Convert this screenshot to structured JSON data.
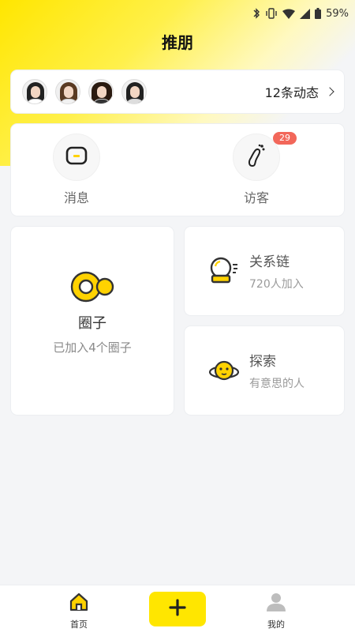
{
  "status_bar": {
    "battery": "59%",
    "icons": [
      "bluetooth-icon",
      "vibrate-icon",
      "wifi-icon",
      "signal-icon",
      "battery-icon"
    ]
  },
  "header": {
    "title": "推朋"
  },
  "feed": {
    "avatars": [
      "avatar-1",
      "avatar-2",
      "avatar-3",
      "avatar-4"
    ],
    "count_text": "12条动态",
    "arrow_icon": "chevron-right-icon"
  },
  "quick": {
    "messages": {
      "label": "消息",
      "icon": "message-icon"
    },
    "visitors": {
      "label": "访客",
      "badge": "29",
      "icon": "footprint-icon"
    }
  },
  "cards": {
    "circles": {
      "title": "圈子",
      "subtitle": "已加入4个圈子",
      "icon": "circle-group-icon"
    },
    "relations": {
      "title": "关系链",
      "subtitle": "720人加入",
      "icon": "crystal-ball-icon"
    },
    "explore": {
      "title": "探索",
      "subtitle": "有意思的人",
      "icon": "planet-face-icon"
    }
  },
  "tabbar": {
    "home": {
      "label": "首页",
      "icon": "home-icon"
    },
    "add": {
      "icon": "plus-icon"
    },
    "mine": {
      "label": "我的",
      "icon": "user-icon"
    }
  },
  "colors": {
    "accent": "#ffe600",
    "badge": "#f2675a",
    "background": "#f4f5f7"
  }
}
